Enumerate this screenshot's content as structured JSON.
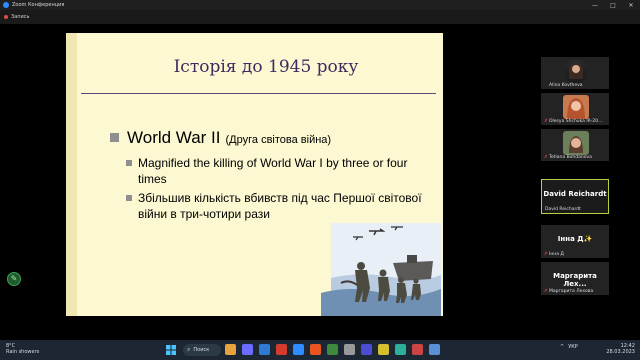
{
  "window": {
    "title": "Zoom Конференция",
    "recording_label": "Запись"
  },
  "slide": {
    "title": "Історія до 1945 року",
    "bullet_main": "World War II",
    "bullet_main_ua": "(Друга світова війна)",
    "sub_bullets": [
      "Magnified the killing of World War I by three or four times",
      "Збільшив кількість вбивств під час Першої світової війни в три-чотири рази"
    ]
  },
  "participants": [
    {
      "name": "Alina Kovtheva"
    },
    {
      "name": "Olesya Shchuka IR-20..."
    },
    {
      "name": "Tetiana Bohdanova"
    },
    {
      "name": "David Reichardt",
      "display": "David Reichardt"
    },
    {
      "name": "Інна Д",
      "display": "Інна Д✨"
    },
    {
      "name": "Маргарита Лехова",
      "display": "Маргарита Лех..."
    }
  ],
  "taskbar": {
    "weather_temp": "8°C",
    "weather_desc": "Rain showers",
    "search_label": "Поиск",
    "lang": "УКР",
    "time": "12:42",
    "date": "28.03.2023"
  },
  "colors": {
    "slide_bg": "#fbf8d2",
    "title_color": "#3d2b60",
    "active_border": "#b7d13a",
    "taskbar_bg": "#1c2733"
  }
}
